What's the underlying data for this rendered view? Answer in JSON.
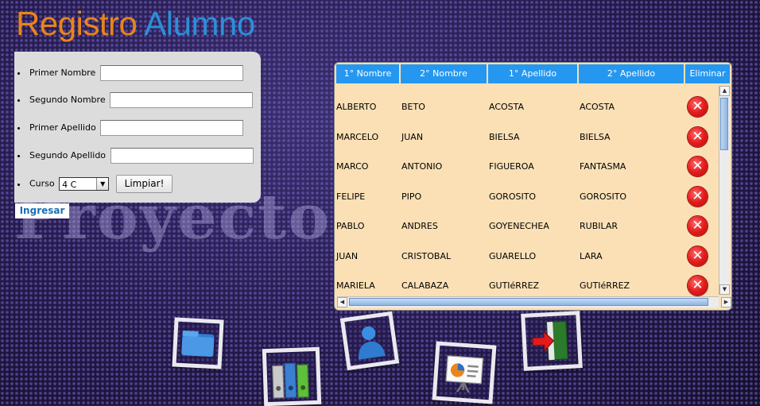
{
  "header": {
    "title_part1": "Registro",
    "title_part2": "Alumno"
  },
  "watermark": "Proyecto Escolar",
  "form": {
    "first_name_label": "Primer Nombre",
    "second_name_label": "Segundo Nombre",
    "first_surname_label": "Primer Apellido",
    "second_surname_label": "Segundo Apellido",
    "course_label": "Curso",
    "course_value": "4 C",
    "first_name_value": "",
    "second_name_value": "",
    "first_surname_value": "",
    "second_surname_value": "",
    "clear_button": "Limpiar!",
    "submit_button": "Ingresar"
  },
  "table": {
    "headers": [
      "1° Nombre",
      "2° Nombre",
      "1° Apellido",
      "2° Apellido",
      "Eliminar"
    ],
    "rows": [
      [
        "ALBERTO",
        "BETO",
        "ACOSTA",
        "ACOSTA"
      ],
      [
        "MARCELO",
        "JUAN",
        "BIELSA",
        "BIELSA"
      ],
      [
        "MARCO",
        "ANTONIO",
        "FIGUEROA",
        "FANTASMA"
      ],
      [
        "FELIPE",
        "PIPO",
        "GOROSITO",
        "GOROSITO"
      ],
      [
        "PABLO",
        "ANDRES",
        "GOYENECHEA",
        "RUBILAR"
      ],
      [
        "JUAN",
        "CRISTOBAL",
        "GUARELLO",
        "LARA"
      ],
      [
        "MARIELA",
        "CALABAZA",
        "GUTIéRREZ",
        "GUTIéRREZ"
      ]
    ],
    "delete_icon": "close-circle-icon",
    "delete_color": "#e41b1b",
    "header_color": "#2597f0",
    "row_color": "#fbe0b6"
  },
  "toolbar": {
    "icons": [
      "folder-icon",
      "binders-icon",
      "user-icon",
      "presentation-icon",
      "exit-door-icon"
    ]
  },
  "colors": {
    "title1": "#e8851a",
    "title2": "#2a90d8",
    "panel": "#dcdcdc"
  }
}
